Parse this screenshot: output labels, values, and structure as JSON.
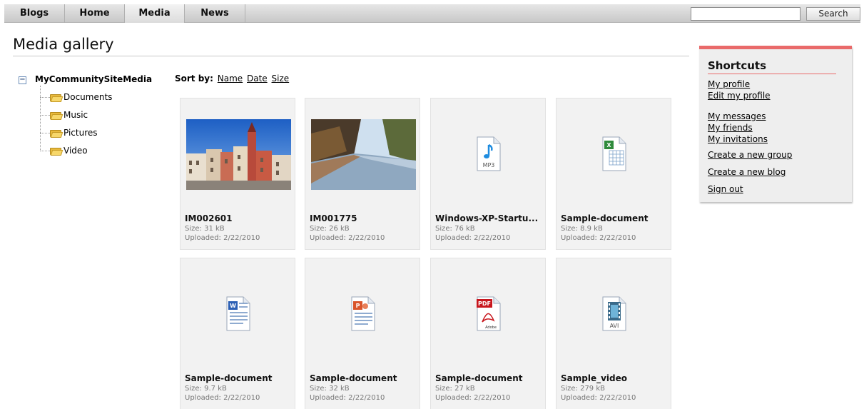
{
  "nav": {
    "items": [
      "Blogs",
      "Home",
      "Media",
      "News"
    ],
    "active": "Media",
    "search_button": "Search",
    "search_value": ""
  },
  "page": {
    "title": "Media gallery"
  },
  "tree": {
    "root": "MyCommunitySiteMedia",
    "toggle": "−",
    "children": [
      "Documents",
      "Music",
      "Pictures",
      "Video"
    ]
  },
  "sort": {
    "label": "Sort by:",
    "options": [
      "Name",
      "Date",
      "Size"
    ]
  },
  "files": [
    {
      "name": "IM002601",
      "size": "Size: 31 kB",
      "uploaded": "Uploaded: 2/22/2010",
      "icon": "photo-town-square"
    },
    {
      "name": "IM001775",
      "size": "Size: 26 kB",
      "uploaded": "Uploaded: 2/22/2010",
      "icon": "photo-river"
    },
    {
      "name": "Windows-XP-Startu...",
      "size": "Size: 76 kB",
      "uploaded": "Uploaded: 2/22/2010",
      "icon": "mp3-file-icon",
      "icon_label": "MP3"
    },
    {
      "name": "Sample-document",
      "size": "Size: 8.9 kB",
      "uploaded": "Uploaded: 2/22/2010",
      "icon": "excel-file-icon"
    },
    {
      "name": "Sample-document",
      "size": "Size: 9.7 kB",
      "uploaded": "Uploaded: 2/22/2010",
      "icon": "word-file-icon"
    },
    {
      "name": "Sample-document",
      "size": "Size: 32 kB",
      "uploaded": "Uploaded: 2/22/2010",
      "icon": "powerpoint-file-icon"
    },
    {
      "name": "Sample-document",
      "size": "Size: 27 kB",
      "uploaded": "Uploaded: 2/22/2010",
      "icon": "pdf-file-icon",
      "icon_label": "PDF",
      "icon_sublabel": "Adobe"
    },
    {
      "name": "Sample_video",
      "size": "Size: 279 kB",
      "uploaded": "Uploaded: 2/22/2010",
      "icon": "avi-file-icon",
      "icon_label": "AVI"
    }
  ],
  "shortcuts": {
    "title": "Shortcuts",
    "links": [
      "My profile",
      "Edit my profile",
      "My messages",
      "My friends",
      "My invitations",
      "Create a new group",
      "Create a new blog",
      "Sign out"
    ]
  },
  "colors": {
    "accent": "#e96a6a",
    "nav_bg": "#d4d4d4",
    "tile_bg": "#f2f2f2",
    "panel_bg": "#eeeeee"
  }
}
